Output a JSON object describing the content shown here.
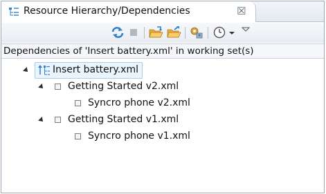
{
  "view": {
    "tab_title": "Resource Hierarchy/Dependencies",
    "close_symbol": "☒",
    "icons": {
      "tab": "hierarchy-view-icon",
      "refresh": "refresh-icon",
      "stop": "stop-icon",
      "open_folder": "open-folder-icon",
      "open_folder_alt": "open-folder-arrow-icon",
      "configure": "configure-icon",
      "history": "history-icon",
      "view_menu": "view-menu-icon"
    },
    "colors": {
      "accent": "#2f7fc9",
      "selection_bg": "#eaf4fd",
      "selection_border": "#a9cdef"
    }
  },
  "header": {
    "text": "Dependencies of 'Insert battery.xml' in working set(s)"
  },
  "tree": {
    "root": {
      "label": "Insert battery.xml",
      "expanded": true,
      "selected": true
    },
    "children": [
      {
        "label": "Getting Started v2.xml",
        "expanded": true,
        "children": [
          {
            "label": "Syncro phone v2.xml"
          }
        ]
      },
      {
        "label": "Getting Started v1.xml",
        "expanded": true,
        "children": [
          {
            "label": "Syncro phone v1.xml"
          }
        ]
      }
    ]
  }
}
